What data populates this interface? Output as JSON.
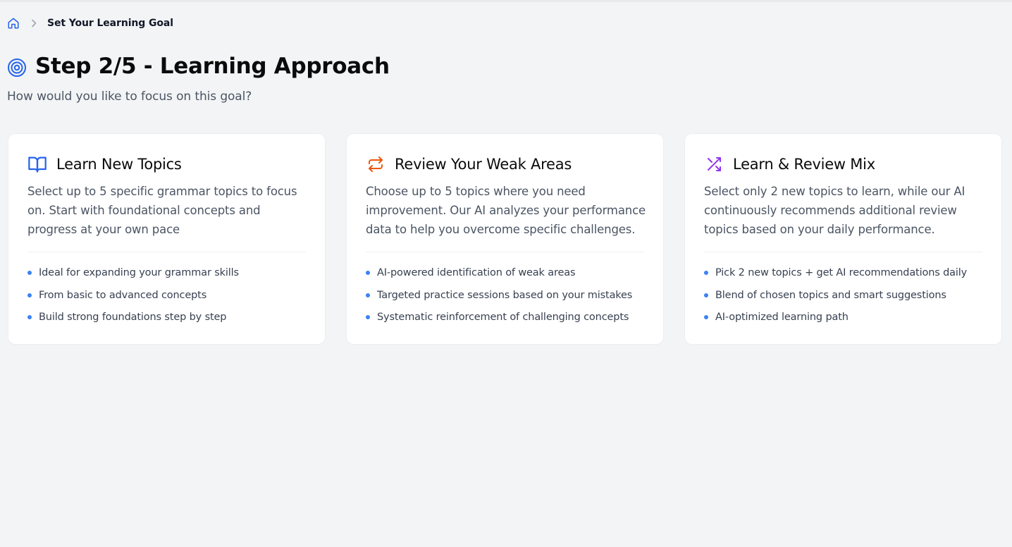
{
  "breadcrumb": {
    "home_icon": "home-icon",
    "separator_icon": "chevron-right-icon",
    "current": "Set Your Learning Goal"
  },
  "header": {
    "icon": "target-icon",
    "title": "Step 2/5 - Learning Approach",
    "subtitle": "How would you like to focus on this goal?"
  },
  "colors": {
    "accent_blue": "#2563eb",
    "accent_orange": "#ea580c",
    "accent_purple": "#9333ea",
    "bullet": "#3b82f6"
  },
  "cards": [
    {
      "icon": "open-book-icon",
      "title": "Learn New Topics",
      "description": "Select up to 5 specific grammar topics to focus on. Start with foundational concepts and progress at your own pace",
      "features": [
        "Ideal for expanding your grammar skills",
        "From basic to advanced concepts",
        "Build strong foundations step by step"
      ]
    },
    {
      "icon": "repeat-icon",
      "title": "Review Your Weak Areas",
      "description": "Choose up to 5 topics where you need improvement. Our AI analyzes your performance data to help you overcome specific challenges.",
      "features": [
        "AI-powered identification of weak areas",
        "Targeted practice sessions based on your mistakes",
        "Systematic reinforcement of challenging concepts"
      ]
    },
    {
      "icon": "shuffle-icon",
      "title": "Learn & Review Mix",
      "description": "Select only 2 new topics to learn, while our AI continuously recommends additional review topics based on your daily performance.",
      "features": [
        "Pick 2 new topics + get AI recommendations daily",
        "Blend of chosen topics and smart suggestions",
        "AI-optimized learning path"
      ]
    }
  ]
}
